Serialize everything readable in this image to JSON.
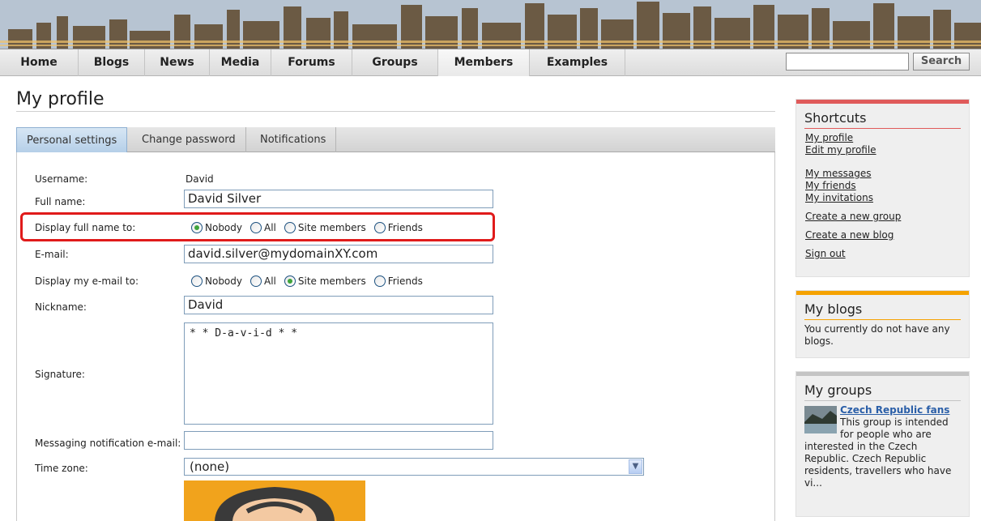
{
  "nav": {
    "items": [
      {
        "label": "Home"
      },
      {
        "label": "Blogs"
      },
      {
        "label": "News"
      },
      {
        "label": "Media"
      },
      {
        "label": "Forums"
      },
      {
        "label": "Groups"
      },
      {
        "label": "Members"
      },
      {
        "label": "Examples"
      }
    ],
    "active": "Members",
    "search_value": "",
    "search_button": "Search"
  },
  "page": {
    "title": "My profile"
  },
  "tabs": [
    {
      "label": "Personal settings",
      "active": true
    },
    {
      "label": "Change password",
      "active": false
    },
    {
      "label": "Notifications",
      "active": false
    }
  ],
  "form": {
    "username_label": "Username:",
    "username_value": "David",
    "fullname_label": "Full name:",
    "fullname_value": "David Silver",
    "display_fullname_label": "Display full name to:",
    "display_fullname_options": [
      "Nobody",
      "All",
      "Site members",
      "Friends"
    ],
    "display_fullname_selected": "Nobody",
    "email_label": "E-mail:",
    "email_value": "david.silver@mydomainXY.com",
    "display_email_label": "Display my e-mail to:",
    "display_email_options": [
      "Nobody",
      "All",
      "Site members",
      "Friends"
    ],
    "display_email_selected": "Site members",
    "nickname_label": "Nickname:",
    "nickname_value": "David",
    "signature_label": "Signature:",
    "signature_value": "* * D-a-v-i-d * *",
    "messaging_label": "Messaging notification e-mail:",
    "messaging_value": "",
    "timezone_label": "Time zone:",
    "timezone_value": "(none)"
  },
  "sidebar": {
    "shortcuts": {
      "title": "Shortcuts",
      "accent": "#e05a5a",
      "links": [
        "My profile",
        "Edit my profile",
        "My messages",
        "My friends",
        "My invitations",
        "Create a new group",
        "Create a new blog",
        "Sign out"
      ]
    },
    "blogs": {
      "title": "My blogs",
      "accent": "#f5a200",
      "text": "You currently do not have any blogs."
    },
    "groups": {
      "title": "My groups",
      "accent": "#c4c4c4",
      "group_name": "Czech Republic fans",
      "group_text": "This group is intended for people who are interested in the Czech Republic. Czech Republic residents, travellers who have vi..."
    }
  }
}
